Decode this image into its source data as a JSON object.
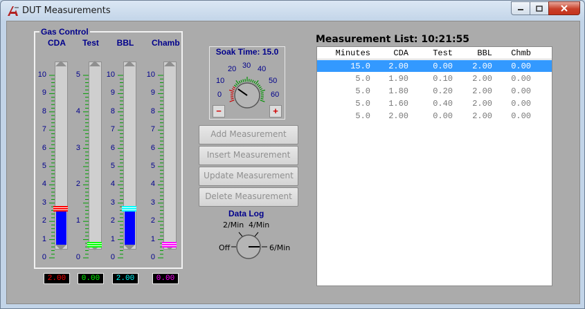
{
  "window": {
    "title": "DUT Measurements",
    "icon": "app-logo-icon"
  },
  "gas_control": {
    "title": "Gas Control",
    "channels": [
      {
        "name": "CDA",
        "value": 2.0,
        "max": 10,
        "readout": "2.00",
        "color": "#ff0000",
        "fill": "#0000ff",
        "ticks": [
          "10",
          "9",
          "8",
          "7",
          "6",
          "5",
          "4",
          "3",
          "2",
          "1",
          "0"
        ]
      },
      {
        "name": "Test",
        "value": 0.0,
        "max": 5,
        "readout": "0.00",
        "color": "#00ff00",
        "fill": "#0000ff",
        "ticks": [
          "5",
          "",
          "",
          "",
          "",
          "4",
          "",
          "",
          "",
          "",
          "3",
          "",
          "",
          "",
          "",
          "2",
          "",
          "",
          "",
          "",
          "1",
          "",
          "",
          "",
          "",
          "0"
        ]
      },
      {
        "name": "BBL",
        "value": 2.0,
        "max": 10,
        "readout": "2.00",
        "color": "#00ffff",
        "fill": "#0000ff",
        "ticks": [
          "10",
          "9",
          "8",
          "7",
          "6",
          "5",
          "4",
          "3",
          "2",
          "1",
          "0"
        ]
      },
      {
        "name": "Chamb",
        "value": 0.0,
        "max": 10,
        "readout": "0.00",
        "color": "#ff00ff",
        "fill": "#0000ff",
        "ticks": [
          "10",
          "9",
          "8",
          "7",
          "6",
          "5",
          "4",
          "3",
          "2",
          "1",
          "0"
        ]
      }
    ]
  },
  "soak_time": {
    "title": "Soak Time: 15.0",
    "value": 15.0,
    "dial_labels": [
      "0",
      "10",
      "20",
      "30",
      "40",
      "50",
      "60"
    ],
    "minus": "−",
    "plus": "+"
  },
  "buttons": {
    "add": "Add Measurement",
    "insert": "Insert Measurement",
    "update": "Update Measurement",
    "delete": "Delete Measurement"
  },
  "data_log": {
    "title": "Data Log",
    "labels": [
      "Off",
      "2/Min",
      "4/Min",
      "6/Min"
    ],
    "selected": "6/Min"
  },
  "measurement_list": {
    "title": "Measurement List: 10:21:55",
    "columns": [
      "Minutes",
      "CDA",
      "Test",
      "BBL",
      "Chmb"
    ],
    "rows": [
      [
        "15.0",
        "2.00",
        "0.00",
        "2.00",
        "0.00"
      ],
      [
        "5.0",
        "1.90",
        "0.10",
        "2.00",
        "0.00"
      ],
      [
        "5.0",
        "1.80",
        "0.20",
        "2.00",
        "0.00"
      ],
      [
        "5.0",
        "1.60",
        "0.40",
        "2.00",
        "0.00"
      ],
      [
        "5.0",
        "2.00",
        "0.00",
        "2.00",
        "0.00"
      ]
    ],
    "selected_row": 0
  }
}
